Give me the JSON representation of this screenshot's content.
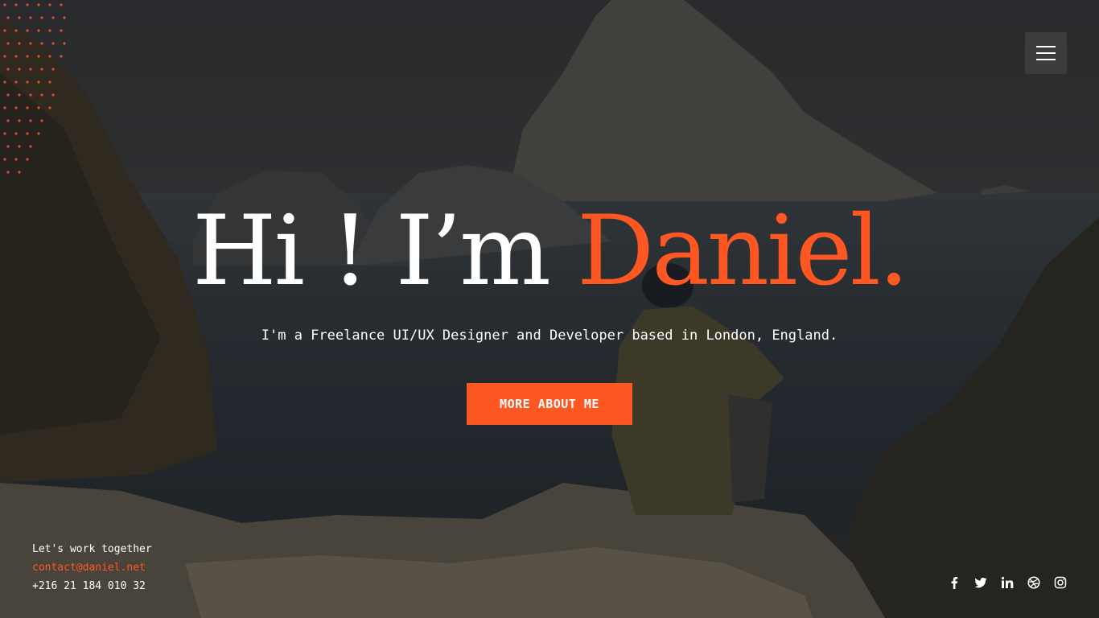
{
  "nav": {
    "menu_icon": "hamburger-menu-icon"
  },
  "hero": {
    "greeting": "Hi ! I’m ",
    "name": "Daniel.",
    "tagline": "I'm a Freelance UI/UX Designer and Developer based in London, England.",
    "cta_label": "MORE ABOUT ME"
  },
  "contact": {
    "heading": "Let's work together",
    "email": "contact@daniel.net",
    "phone": "+216 21 184 010 32"
  },
  "social": [
    {
      "icon": "facebook-icon"
    },
    {
      "icon": "twitter-icon"
    },
    {
      "icon": "linkedin-icon"
    },
    {
      "icon": "dribbble-icon"
    },
    {
      "icon": "instagram-icon"
    }
  ],
  "colors": {
    "accent": "#ff5722",
    "background": "#2a2c2f"
  }
}
